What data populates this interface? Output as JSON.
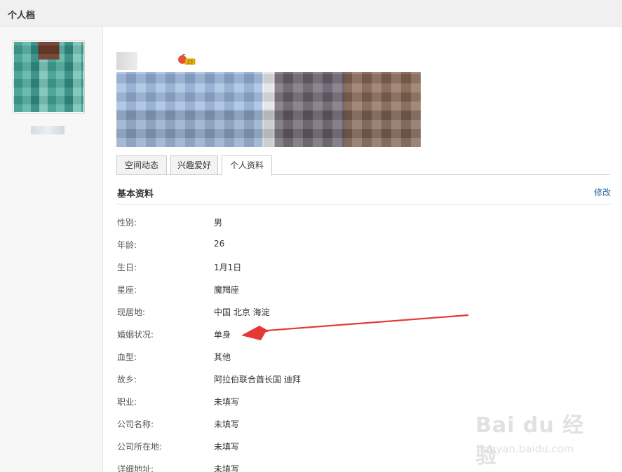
{
  "window": {
    "title": "个人档"
  },
  "tabs": [
    {
      "label": "空间动态"
    },
    {
      "label": "兴趣爱好"
    },
    {
      "label": "个人资料"
    }
  ],
  "section": {
    "title": "基本资料",
    "edit_label": "修改"
  },
  "profile": [
    {
      "label": "性别:",
      "value": "男"
    },
    {
      "label": "年龄:",
      "value": "26"
    },
    {
      "label": "生日:",
      "value": "1月1日"
    },
    {
      "label": "星座:",
      "value": "魔羯座"
    },
    {
      "label": "现居地:",
      "value": "中国 北京 海淀"
    },
    {
      "label": "婚姻状况:",
      "value": "单身"
    },
    {
      "label": "血型:",
      "value": "其他"
    },
    {
      "label": "故乡:",
      "value": "阿拉伯联合酋长国 迪拜"
    },
    {
      "label": "职业:",
      "value": "未填写"
    },
    {
      "label": "公司名称:",
      "value": "未填写"
    },
    {
      "label": "公司所在地:",
      "value": "未填写"
    },
    {
      "label": "详细地址:",
      "value": "未填写"
    }
  ],
  "badge": {
    "text": "23"
  },
  "watermark": {
    "logo": "Bai du 经验",
    "url": "jingyan.baidu.com"
  },
  "colors": {
    "accent_link": "#2b6ea5",
    "arrow": "#e53935"
  },
  "icons": {
    "badge": "fruit-level-icon",
    "avatar": "user-avatar"
  }
}
